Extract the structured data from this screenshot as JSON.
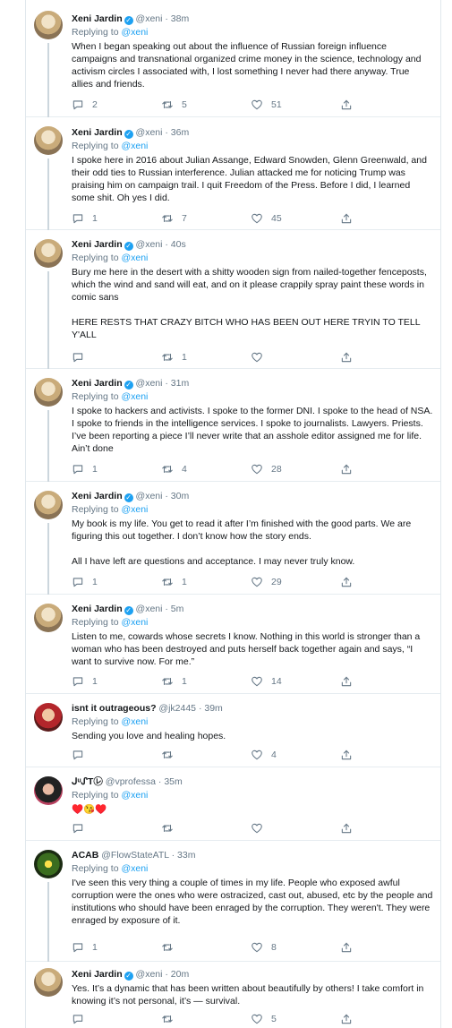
{
  "tweets": [
    {
      "name": "Xeni Jardin",
      "verified": true,
      "handle": "@xeni",
      "time": "38m",
      "replying_label": "Replying to",
      "replying_to": "@xeni",
      "text": "When I began speaking out about the influence of Russian foreign influence campaigns and transnational organized crime money in the science, technology and activism circles I associated with, I lost something I never had there anyway. True allies and friends.",
      "replies": "2",
      "retweets": "5",
      "likes": "51"
    },
    {
      "name": "Xeni Jardin",
      "verified": true,
      "handle": "@xeni",
      "time": "36m",
      "replying_label": "Replying to",
      "replying_to": "@xeni",
      "text": "I spoke here in 2016 about Julian Assange, Edward Snowden, Glenn Greenwald, and their odd ties to Russian interference. Julian attacked me for noticing Trump was praising him on campaign trail. I quit Freedom of the Press. Before I did, I learned some shit. Oh yes I did.",
      "replies": "1",
      "retweets": "7",
      "likes": "45"
    },
    {
      "name": "Xeni Jardin",
      "verified": true,
      "handle": "@xeni",
      "time": "40s",
      "replying_label": "Replying to",
      "replying_to": "@xeni",
      "text": "Bury me here in the desert with a shitty wooden sign from nailed-together fenceposts, which the wind and sand will eat, and on it please crappily spray paint these words in comic sans\n\nHERE RESTS THAT CRAZY BITCH WHO HAS BEEN OUT HERE TRYIN TO TELL Y'ALL",
      "replies": "",
      "retweets": "1",
      "likes": ""
    },
    {
      "name": "Xeni Jardin",
      "verified": true,
      "handle": "@xeni",
      "time": "31m",
      "replying_label": "Replying to",
      "replying_to": "@xeni",
      "text": "I spoke to hackers and activists. I spoke to the former DNI. I spoke to the head of NSA. I spoke to friends in the intelligence services. I spoke to journalists. Lawyers. Priests. I’ve been reporting a piece I’ll never write that an asshole editor assigned me for life. Ain’t done",
      "replies": "1",
      "retweets": "4",
      "likes": "28"
    },
    {
      "name": "Xeni Jardin",
      "verified": true,
      "handle": "@xeni",
      "time": "30m",
      "replying_label": "Replying to",
      "replying_to": "@xeni",
      "text": "My book is my life. You get to read it after I’m finished with the good parts. We are figuring this out together. I don’t know how the story ends.\n\nAll I have left are questions and acceptance. I may never truly know.",
      "replies": "1",
      "retweets": "1",
      "likes": "29"
    },
    {
      "name": "Xeni Jardin",
      "verified": true,
      "handle": "@xeni",
      "time": "5m",
      "replying_label": "Replying to",
      "replying_to": "@xeni",
      "text": "Listen to me, cowards whose secrets I know. Nothing in this world is stronger than a woman who has been destroyed and puts herself back together again and says, “I want to survive now. For me.”",
      "replies": "1",
      "retweets": "1",
      "likes": "14"
    },
    {
      "name": "isnt it outrageous?",
      "verified": false,
      "handle": "@jk2445",
      "time": "39m",
      "replying_label": "Replying to",
      "replying_to": "@xeni",
      "text": "Sending you love and healing hopes.",
      "replies": "",
      "retweets": "",
      "likes": "4"
    },
    {
      "name": "ᒍᵘᔑT㋹",
      "verified": false,
      "handle": "@vprofessa",
      "time": "35m",
      "replying_label": "Replying to",
      "replying_to": "@xeni",
      "text": "♥️😘♥️",
      "replies": "",
      "retweets": "",
      "likes": ""
    },
    {
      "name": "ACAB",
      "verified": false,
      "handle": "@FlowStateATL",
      "time": "33m",
      "replying_label": "Replying to",
      "replying_to": "@xeni",
      "text": "I've seen this very thing a couple of times in my life. People who exposed awful corruption were the ones who were ostracized, cast out, abused, etc by the people and institutions who should have been enraged by the corruption. They weren't. They were enraged by exposure of it.",
      "replies": "1",
      "retweets": "",
      "likes": "8"
    },
    {
      "name": "Xeni Jardin",
      "verified": true,
      "handle": "@xeni",
      "time": "20m",
      "replying_label": "Replying to",
      "replying_to": "@xeni",
      "text": "Yes. It’s a dynamic that has been written about beautifully by others! I take comfort in knowing it’s not personal, it’s — survival.",
      "replies": "",
      "retweets": "",
      "likes": "5"
    }
  ],
  "icons": {
    "reply": "reply-icon",
    "retweet": "retweet-icon",
    "like": "heart-icon",
    "share": "share-icon"
  },
  "colors": {
    "accent": "#1da1f2",
    "muted": "#657786",
    "text": "#14171a",
    "border": "#e6ecf0"
  }
}
